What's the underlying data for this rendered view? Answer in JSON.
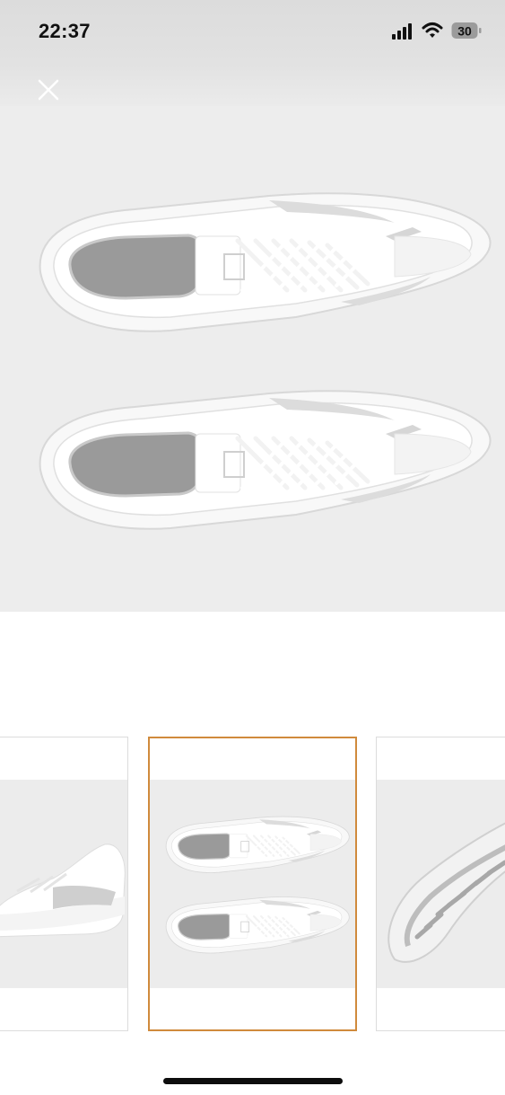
{
  "status_bar": {
    "time": "22:37",
    "battery_level": "30",
    "icons": [
      "cellular-signal-icon",
      "wifi-icon",
      "battery-icon"
    ]
  },
  "gallery": {
    "close_icon": "close-icon",
    "main_image": "shoe-pair-top-view",
    "thumbnails": [
      {
        "image": "shoe-side-view",
        "selected": false
      },
      {
        "image": "shoe-pair-top-view",
        "selected": true
      },
      {
        "image": "shoe-outsole-view",
        "selected": false
      }
    ],
    "selected_border_color": "#d08a3c"
  },
  "colors": {
    "image_background": "#ededed",
    "shoe_white": "#f7f7f7",
    "shoe_gray": "#9a9a9a"
  }
}
